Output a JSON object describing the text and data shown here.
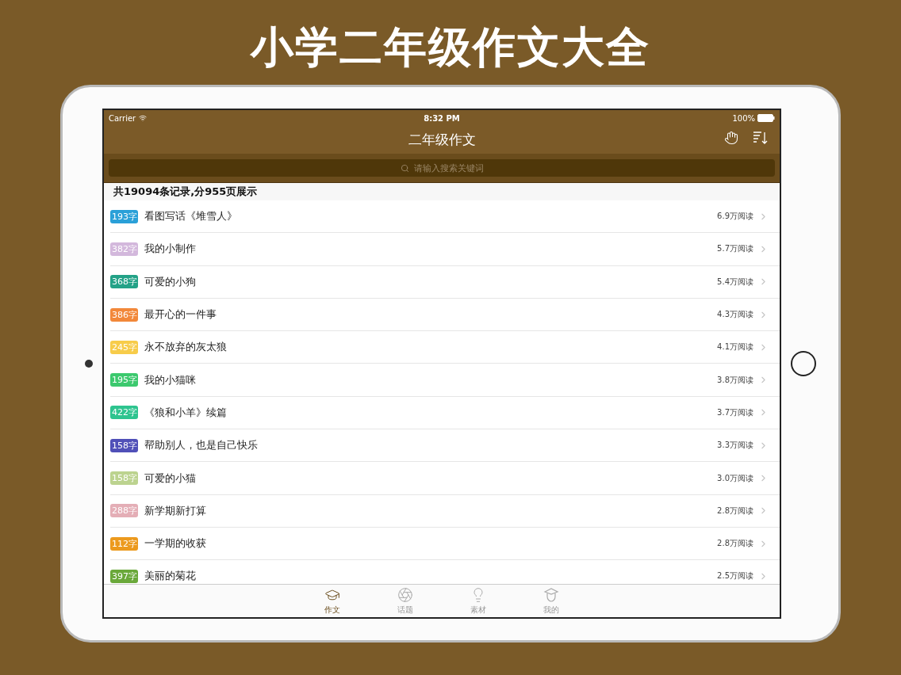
{
  "headline": "小学二年级作文大全",
  "status_bar": {
    "carrier": "Carrier",
    "time": "8:32 PM",
    "battery": "100%"
  },
  "nav_bar": {
    "title": "二年级作文"
  },
  "search": {
    "placeholder": "请输入搜索关键词"
  },
  "summary": "共19094条记录,分955页展示",
  "articles": [
    {
      "words": "193字",
      "color": "#2aa0d8",
      "title": "看图写话《堆雪人》",
      "reads": "6.9万阅读"
    },
    {
      "words": "382字",
      "color": "#d3b8dc",
      "title": "我的小制作",
      "reads": "5.7万阅读"
    },
    {
      "words": "368字",
      "color": "#23a287",
      "title": "可爱的小狗",
      "reads": "5.4万阅读"
    },
    {
      "words": "386字",
      "color": "#f2883a",
      "title": "最开心的一件事",
      "reads": "4.3万阅读"
    },
    {
      "words": "245字",
      "color": "#f7cc4a",
      "title": "永不放弃的灰太狼",
      "reads": "4.1万阅读"
    },
    {
      "words": "195字",
      "color": "#3cc96e",
      "title": "我的小猫咪",
      "reads": "3.8万阅读"
    },
    {
      "words": "422字",
      "color": "#2ec48f",
      "title": "《狼和小羊》续篇",
      "reads": "3.7万阅读"
    },
    {
      "words": "158字",
      "color": "#5050b8",
      "title": "帮助别人，也是自己快乐",
      "reads": "3.3万阅读"
    },
    {
      "words": "158字",
      "color": "#bcd38f",
      "title": "可爱的小猫",
      "reads": "3.0万阅读"
    },
    {
      "words": "288字",
      "color": "#e4aeb6",
      "title": "新学期新打算",
      "reads": "2.8万阅读"
    },
    {
      "words": "112字",
      "color": "#ec9a1e",
      "title": "一学期的收获",
      "reads": "2.8万阅读"
    },
    {
      "words": "397字",
      "color": "#6aa83a",
      "title": "美丽的菊花",
      "reads": "2.5万阅读"
    }
  ],
  "tabs": [
    {
      "kind": "cap",
      "label": "作文",
      "selected": true
    },
    {
      "kind": "aperture",
      "label": "话题",
      "selected": false
    },
    {
      "kind": "bulb",
      "label": "素材",
      "selected": false
    },
    {
      "kind": "graduate",
      "label": "我的",
      "selected": false
    }
  ]
}
